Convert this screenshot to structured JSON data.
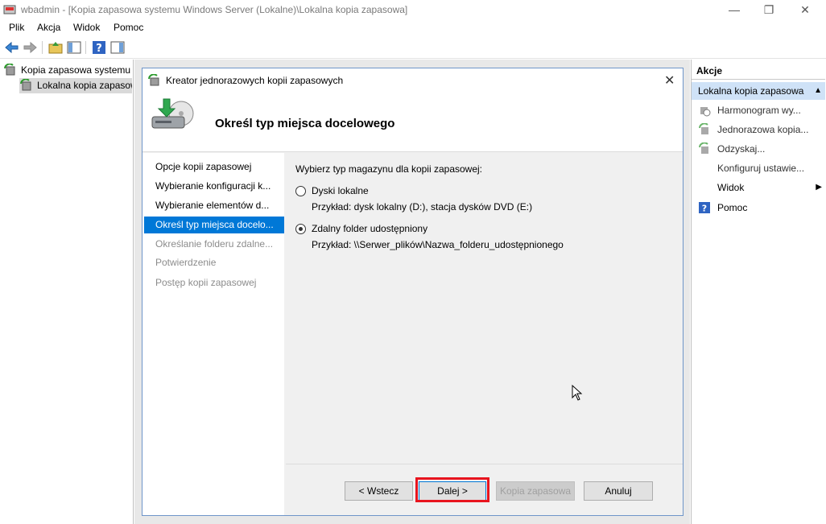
{
  "window": {
    "title": "wbadmin - [Kopia zapasowa systemu Windows Server (Lokalne)\\Lokalna kopia zapasowa]",
    "minimize": "—",
    "maximize": "❐",
    "close": "✕"
  },
  "menu": [
    "Plik",
    "Akcja",
    "Widok",
    "Pomoc"
  ],
  "tree": {
    "root": "Kopia zapasowa systemu Windows Server (Lokalne)",
    "child": "Lokalna kopia zapasowa"
  },
  "actions": {
    "header": "Akcje",
    "section": "Lokalna kopia zapasowa",
    "items": [
      {
        "label": "Harmonogram wy...",
        "icon": "schedule-icon"
      },
      {
        "label": "Jednorazowa kopia...",
        "icon": "backup-once-icon"
      },
      {
        "label": "Odzyskaj...",
        "icon": "recover-icon"
      },
      {
        "label": "Konfiguruj ustawie...",
        "icon": ""
      },
      {
        "label": "Widok",
        "icon": ""
      },
      {
        "label": "Pomoc",
        "icon": "help-icon"
      }
    ]
  },
  "dialog": {
    "title": "Kreator jednorazowych kopii zapasowych",
    "heading": "Określ typ miejsca docelowego",
    "close": "✕",
    "steps": [
      {
        "label": "Opcje kopii zapasowej",
        "state": "done"
      },
      {
        "label": "Wybieranie konfiguracji k...",
        "state": "done"
      },
      {
        "label": "Wybieranie elementów d...",
        "state": "done"
      },
      {
        "label": "Określ typ miejsca docelo...",
        "state": "current"
      },
      {
        "label": "Określanie folderu zdalne...",
        "state": "pending"
      },
      {
        "label": "Potwierdzenie",
        "state": "pending"
      },
      {
        "label": "Postęp kopii zapasowej",
        "state": "pending"
      }
    ],
    "prompt": "Wybierz typ magazynu dla kopii zapasowej:",
    "options": [
      {
        "label": "Dyski lokalne",
        "example": "Przykład: dysk lokalny (D:), stacja dysków DVD (E:)",
        "selected": false
      },
      {
        "label": "Zdalny folder udostępniony",
        "example": "Przykład: \\\\Serwer_plików\\Nazwa_folderu_udostępnionego",
        "selected": true
      }
    ],
    "buttons": {
      "back": "< Wstecz",
      "next": "Dalej >",
      "backup": "Kopia zapasowa",
      "cancel": "Anuluj"
    }
  },
  "colors": {
    "selection": "#0078d7",
    "highlight": "#e8141e",
    "disabled_text": "#a0a0a0"
  }
}
